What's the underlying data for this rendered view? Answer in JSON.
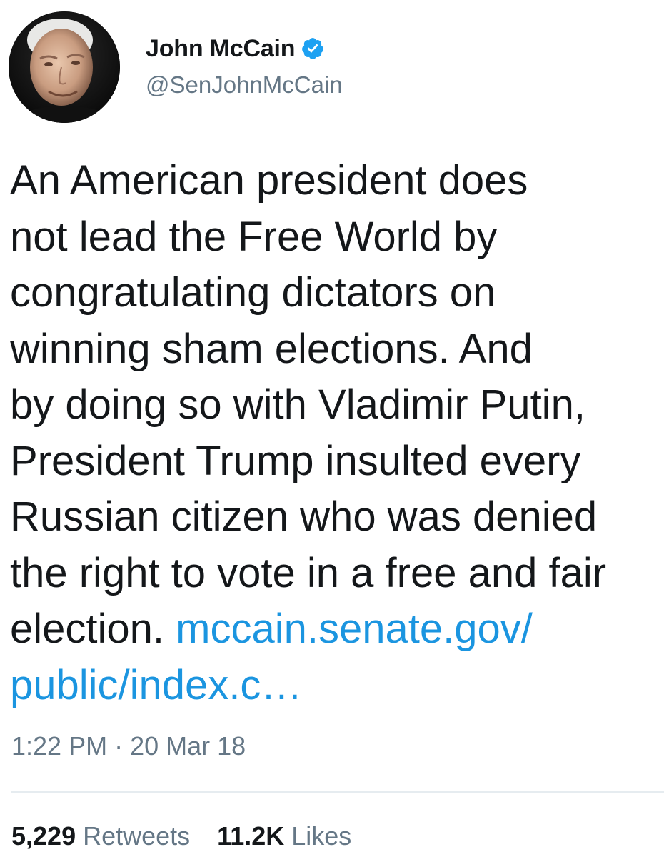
{
  "author": {
    "display_name": "John McCain",
    "handle": "@SenJohnMcCain",
    "verified": true
  },
  "tweet": {
    "text_lines": [
      "An American president does",
      "not lead the Free World by",
      "congratulating dictators on",
      "winning sham elections. And",
      "by doing so with Vladimir Putin,",
      "President Trump insulted every",
      "Russian citizen who was denied",
      "the right to vote in a free and fair"
    ],
    "last_line_text": "election.",
    "link_part1": "mccain.senate.gov/",
    "link_part2": "public/index.c…"
  },
  "meta": {
    "time": "1:22 PM",
    "separator": "·",
    "date": "20 Mar 18"
  },
  "stats": {
    "retweets_count": "5,229",
    "retweets_label": "Retweets",
    "likes_count": "11.2K",
    "likes_label": "Likes"
  },
  "colors": {
    "text": "#14171a",
    "secondary": "#657786",
    "link": "#1b95e0",
    "verified": "#1da1f2",
    "divider": "#e6ecf0"
  },
  "icons": {
    "verified": "verified-badge-icon"
  }
}
